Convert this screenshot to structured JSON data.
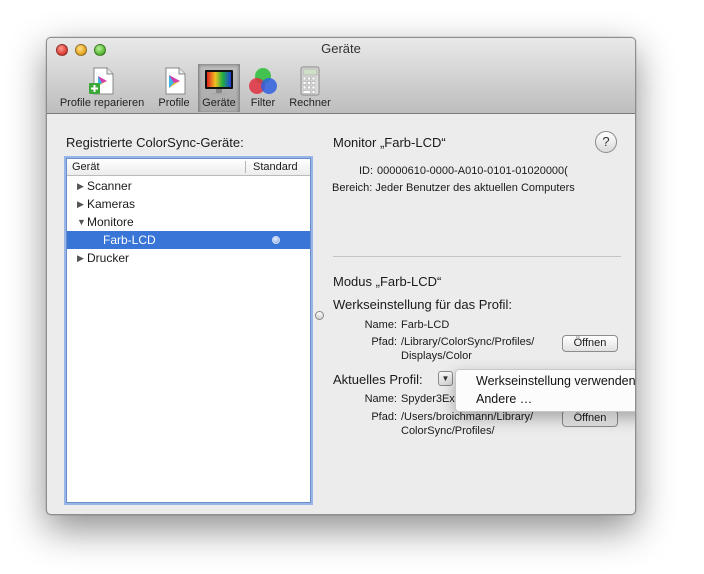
{
  "window": {
    "title": "Geräte"
  },
  "toolbar": {
    "items": [
      {
        "label": "Profile reparieren",
        "icon": "profile-repair-icon",
        "selected": false
      },
      {
        "label": "Profile",
        "icon": "profiles-icon",
        "selected": false
      },
      {
        "label": "Geräte",
        "icon": "display-icon",
        "selected": true
      },
      {
        "label": "Filter",
        "icon": "filter-icon",
        "selected": false
      },
      {
        "label": "Rechner",
        "icon": "calculator-icon",
        "selected": false
      }
    ]
  },
  "left": {
    "heading": "Registrierte ColorSync-Geräte:",
    "columns": {
      "device": "Gerät",
      "default": "Standard"
    },
    "rows": [
      {
        "label": "Scanner",
        "toggle": "▶"
      },
      {
        "label": "Kameras",
        "toggle": "▶"
      },
      {
        "label": "Monitore",
        "toggle": "▼"
      },
      {
        "label": "Farb-LCD",
        "selected": true
      },
      {
        "label": "Drucker",
        "toggle": "▶"
      }
    ]
  },
  "details": {
    "title": "Monitor „Farb-LCD“",
    "help": "?",
    "id_label": "ID:",
    "id_value": "00000610-0000-A010-0101-01020000(",
    "scope_label": "Bereich:",
    "scope_value": "Jeder Benutzer des aktuellen Computers",
    "mode_title": "Modus „Farb-LCD“",
    "factory_title": "Werkseinstellung für das Profil:",
    "factory_name_label": "Name:",
    "factory_name_value": "Farb-LCD",
    "factory_path_label": "Pfad:",
    "factory_path_line1": "/Library/ColorSync/Profiles/",
    "factory_path_line2": "Displays/Color",
    "open_label": "Öffnen",
    "current_title": "Aktuelles Profil:",
    "current_name_label": "Name:",
    "current_name_value": "Spyder3Ex",
    "current_path_label": "Pfad:",
    "current_path_line1": "/Users/broichmann/Library/",
    "current_path_line2": "ColorSync/Profiles/",
    "open_label2": "Öffnen"
  },
  "menu": {
    "items": [
      "Werkseinstellung verwenden",
      "Andere …"
    ]
  }
}
